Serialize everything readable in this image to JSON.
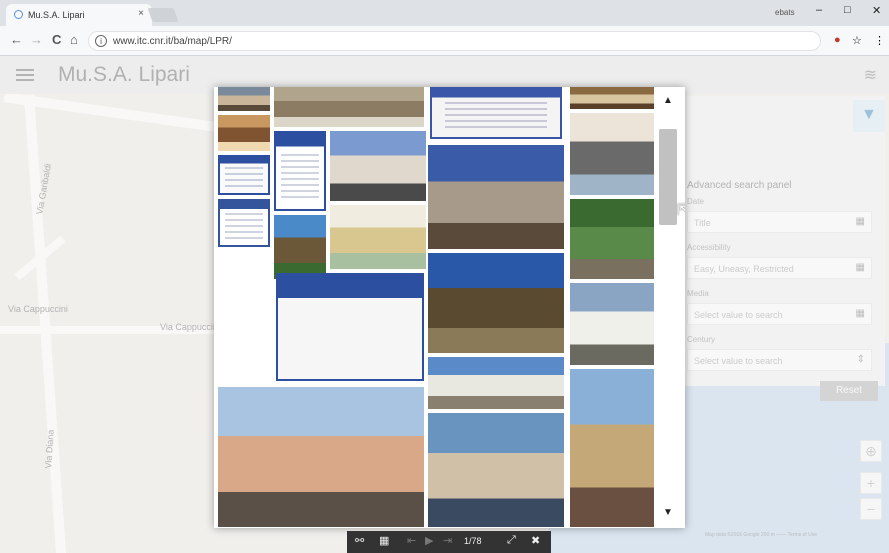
{
  "browser": {
    "tab_title": "Mu.S.A. Lipari",
    "tab_close": "×",
    "window_user": "ebats",
    "minimize": "–",
    "restore": "□",
    "close": "✕",
    "back": "←",
    "forward": "→",
    "reload": "C",
    "home": "⌂",
    "url": "www.itc.cnr.it/ba/map/LPR/",
    "bookmark_icon": "☆",
    "menu_icon": "⋮"
  },
  "app": {
    "title": "Mu.S.A. Lipari"
  },
  "map_labels": [
    "Via Garibaldi",
    "Via Cappuccini",
    "Via Cappuccini",
    "Via Diana"
  ],
  "search_panel": {
    "title": "Advanced search panel",
    "fields": [
      {
        "label": "Date",
        "value": "Title"
      },
      {
        "label": "Accessibility",
        "value": "Easy, Uneasy, Restricted"
      },
      {
        "label": "Media",
        "value": "Select value to search"
      },
      {
        "label": "Century",
        "value": "Select value to search"
      }
    ],
    "reset_label": "Reset"
  },
  "zoom": {
    "plus": "+",
    "minus": "−"
  },
  "attribution": "Map data ©2016 Google   200 m ——   Terms of Use",
  "viewer": {
    "counter": "1/78",
    "expand": "⤢",
    "close": "✖"
  },
  "thumbnails": [
    {
      "type": "street",
      "colors": [
        "#7a8a9a",
        "#c9b59a",
        "#5a4a3a"
      ]
    },
    {
      "type": "aerial",
      "colors": [
        "#b0a48c",
        "#8c7c64",
        "#dcd6c8"
      ]
    },
    {
      "type": "webpage",
      "colors": [
        "#f4f4f4",
        "#3a56a8",
        "#c8c8d8"
      ]
    },
    {
      "type": "arch",
      "colors": [
        "#8a6a40",
        "#d8c6a0",
        "#5a4028"
      ]
    },
    {
      "type": "cloister",
      "colors": [
        "#c89860",
        "#805430",
        "#f0d8b0"
      ]
    },
    {
      "type": "webpage",
      "colors": [
        "#ffffff",
        "#2c4fa0",
        "#d0d4e0"
      ]
    },
    {
      "type": "building",
      "colors": [
        "#7a9ad0",
        "#e0d8cc",
        "#4a4a4a"
      ]
    },
    {
      "type": "church-facade",
      "colors": [
        "#ece4d8",
        "#6a6a6a",
        "#a0b4c8"
      ]
    },
    {
      "type": "webpage",
      "colors": [
        "#fafafa",
        "#2c4fa0",
        "#c8d0e0"
      ]
    },
    {
      "type": "ruins",
      "colors": [
        "#4a8ac8",
        "#6a5838",
        "#3a6a30"
      ]
    },
    {
      "type": "map",
      "colors": [
        "#f0ece0",
        "#d8c890",
        "#a8c0a0"
      ]
    },
    {
      "type": "baroque-portal",
      "colors": [
        "#3a5ca8",
        "#a89a8a",
        "#5a4a3a"
      ]
    },
    {
      "type": "webpage",
      "colors": [
        "#ffffff",
        "#34559c",
        "#d0d4e0"
      ]
    },
    {
      "type": "park",
      "colors": [
        "#3a6a30",
        "#5a8a4a",
        "#7a7060"
      ]
    },
    {
      "type": "amphitheatre",
      "colors": [
        "#2a58a8",
        "#5a4a30",
        "#8a7a58"
      ]
    },
    {
      "type": "white-church",
      "colors": [
        "#8aa4c4",
        "#f0f0ea",
        "#6a6a60"
      ]
    },
    {
      "type": "harbour-building",
      "colors": [
        "#5a8ac8",
        "#e8e8e0",
        "#8a8070"
      ]
    },
    {
      "type": "cathedral",
      "colors": [
        "#a8c4e0",
        "#d8a888",
        "#5a5048"
      ]
    },
    {
      "type": "marina",
      "colors": [
        "#6a94c0",
        "#d0c0a8",
        "#3a4a60"
      ]
    },
    {
      "type": "old-facade",
      "colors": [
        "#8ab0d8",
        "#c4a878",
        "#6a5040"
      ]
    }
  ]
}
